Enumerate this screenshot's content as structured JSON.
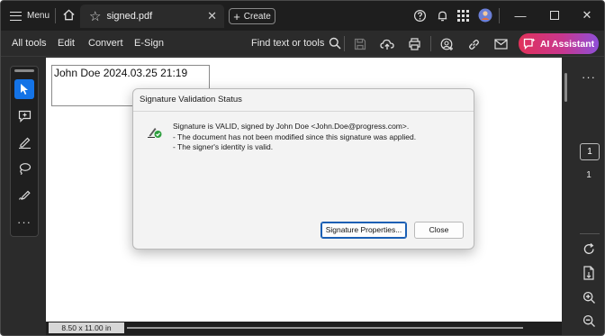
{
  "titlebar": {
    "menu_label": "Menu",
    "tab_title": "signed.pdf",
    "create_label": "Create"
  },
  "toolbar": {
    "all_tools": "All tools",
    "edit": "Edit",
    "convert": "Convert",
    "esign": "E-Sign",
    "find_label": "Find text or tools",
    "ai_label": "AI Assistant"
  },
  "document": {
    "signature_text": "John Doe 2024.03.25 21:19"
  },
  "statusbar": {
    "page_size": "8.50 x 11.00 in"
  },
  "right_rail": {
    "page_input": "1",
    "page_count": "1"
  },
  "dialog": {
    "title": "Signature Validation Status",
    "line1": "Signature is VALID, signed by John Doe <John.Doe@progress.com>.",
    "line2": "- The document has not been modified since this signature was applied.",
    "line3": "- The signer's identity is valid.",
    "properties_button": "Signature Properties...",
    "close_button": "Close"
  },
  "colors": {
    "accent": "#1473e6",
    "valid_green": "#2e9e3e",
    "ai_gradient_start": "#e1315a",
    "ai_gradient_end": "#8e4fd8"
  }
}
